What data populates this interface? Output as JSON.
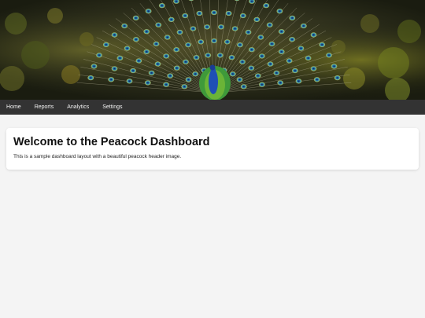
{
  "header": {
    "image_subject": "peacock-header-image"
  },
  "nav": {
    "items": [
      {
        "label": "Home"
      },
      {
        "label": "Reports"
      },
      {
        "label": "Analytics"
      },
      {
        "label": "Settings"
      }
    ]
  },
  "main": {
    "title": "Welcome to the Peacock Dashboard",
    "description": "This is a sample dashboard layout with a beautiful peacock header image."
  },
  "colors": {
    "navbar_bg": "#333333",
    "page_bg": "#f4f4f4",
    "card_bg": "#ffffff"
  }
}
